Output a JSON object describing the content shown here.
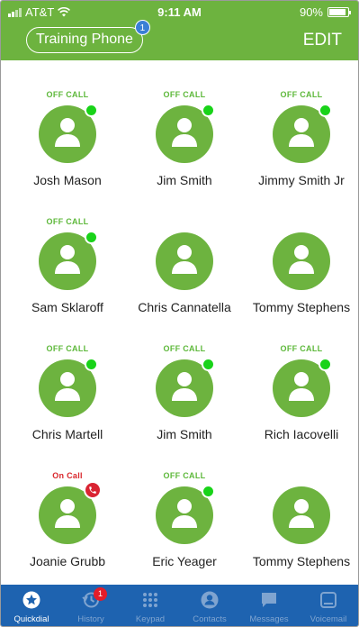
{
  "status_bar": {
    "carrier": "AT&T",
    "time": "9:11 AM",
    "battery": "90%",
    "battery_level": 0.9
  },
  "header": {
    "phone_label": "Training Phone",
    "phone_badge": "1",
    "edit_label": "EDIT"
  },
  "contacts": [
    {
      "name": "Josh Mason",
      "status": "OFF CALL",
      "indicator": "online"
    },
    {
      "name": "Jim Smith",
      "status": "OFF CALL",
      "indicator": "online"
    },
    {
      "name": "Jimmy Smith Jr",
      "status": "OFF CALL",
      "indicator": "online"
    },
    {
      "name": "Sam Sklaroff",
      "status": "OFF CALL",
      "indicator": "online"
    },
    {
      "name": "Chris Cannatella",
      "status": "",
      "indicator": "none"
    },
    {
      "name": "Tommy Stephens",
      "status": "",
      "indicator": "none"
    },
    {
      "name": "Chris Martell",
      "status": "OFF CALL",
      "indicator": "online"
    },
    {
      "name": "Jim Smith",
      "status": "OFF CALL",
      "indicator": "online"
    },
    {
      "name": "Rich Iacovelli",
      "status": "OFF CALL",
      "indicator": "online"
    },
    {
      "name": "Joanie Grubb",
      "status": "On Call",
      "indicator": "on-call"
    },
    {
      "name": "Eric Yeager",
      "status": "OFF CALL",
      "indicator": "online"
    },
    {
      "name": "Tommy Stephens",
      "status": "",
      "indicator": "none"
    }
  ],
  "tabs": [
    {
      "label": "Quickdial",
      "icon": "star-icon",
      "active": true
    },
    {
      "label": "History",
      "icon": "history-icon",
      "badge": "1"
    },
    {
      "label": "Keypad",
      "icon": "keypad-icon"
    },
    {
      "label": "Contacts",
      "icon": "contact-icon"
    },
    {
      "label": "Messages",
      "icon": "message-icon"
    },
    {
      "label": "Voicemail",
      "icon": "voicemail-icon"
    }
  ],
  "colors": {
    "brand_green": "#6db33f",
    "online_dot": "#19d319",
    "on_call": "#d92432",
    "tab_bar": "#1e63b0"
  }
}
